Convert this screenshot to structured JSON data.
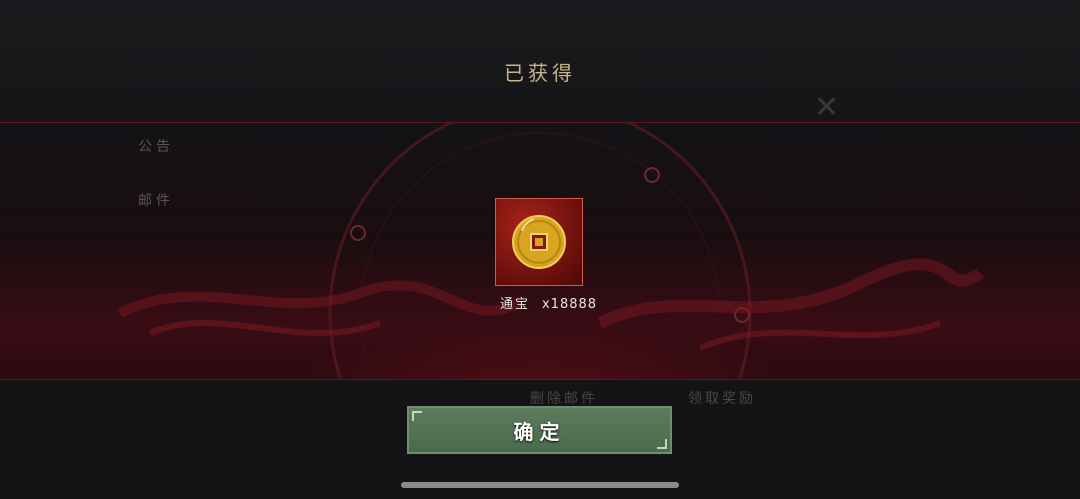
{
  "dialog": {
    "title": "已获得",
    "confirm_label": "确定"
  },
  "reward": {
    "name": "通宝",
    "quantity": "x18888",
    "icon": "copper-coin-icon"
  },
  "background": {
    "sidebar_items": [
      "公告",
      "邮件"
    ],
    "footer_buttons": [
      "删除邮件",
      "领取奖励"
    ]
  },
  "colors": {
    "title": "#c8b48a",
    "item_border": "#d25a4a",
    "confirm_button": "#4f6f51",
    "band": "#3a0c14"
  }
}
